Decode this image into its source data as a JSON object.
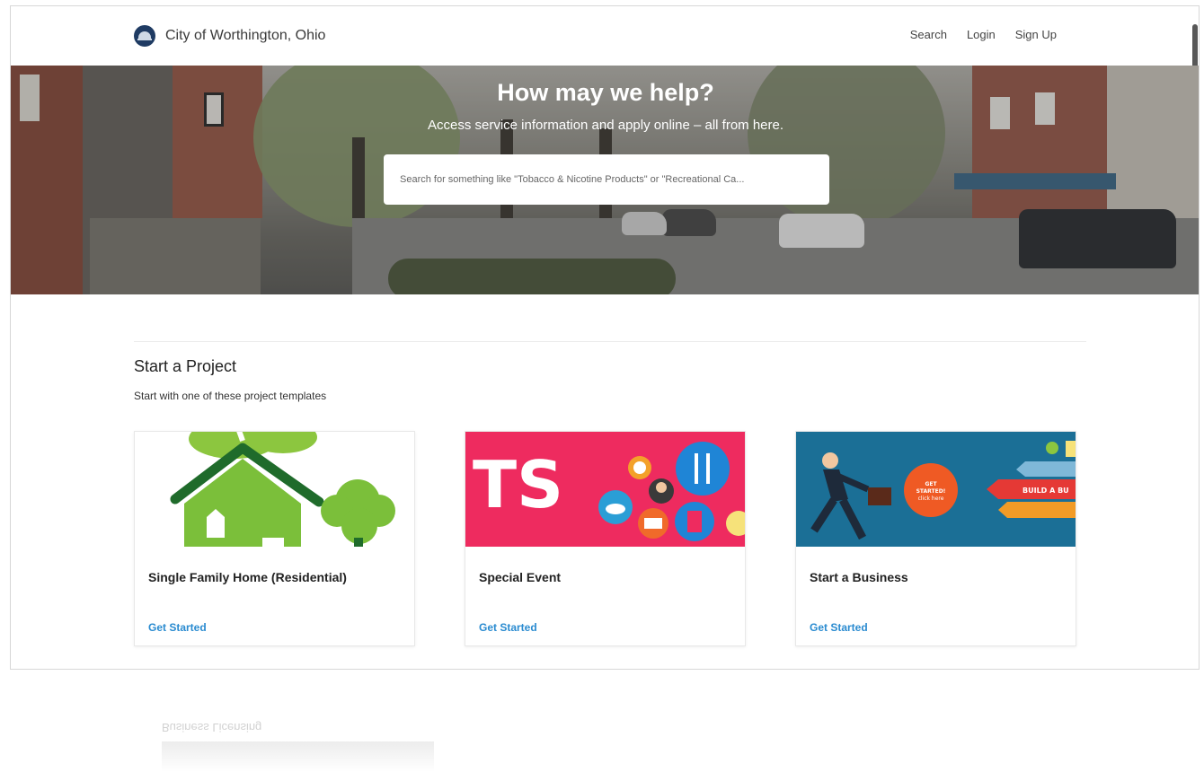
{
  "header": {
    "site_name": "City of Worthington, Ohio",
    "nav": {
      "search": "Search",
      "login": "Login",
      "signup": "Sign Up"
    }
  },
  "hero": {
    "title": "How may we help?",
    "subtitle": "Access service information and apply online – all from here.",
    "search_placeholder": "Search for something like \"Tobacco & Nicotine Products\" or \"Recreational Ca..."
  },
  "projects": {
    "title": "Start a Project",
    "subtitle": "Start with one of these project templates",
    "cards": [
      {
        "title": "Single Family Home (Residential)",
        "link": "Get Started",
        "image_icon": "house-tree-illustration"
      },
      {
        "title": "Special Event",
        "link": "Get Started",
        "image_icon": "event-icons-illustration",
        "image_text": "TS"
      },
      {
        "title": "Start a Business",
        "link": "Get Started",
        "image_icon": "businessman-running-illustration",
        "image_badge": [
          "GET",
          "STARTED!",
          "click here"
        ],
        "image_banner": "BUILD A BU"
      }
    ]
  },
  "reflection": {
    "label": "Business Licensing"
  },
  "colors": {
    "link": "#2a8bd0",
    "logo": "#1f3b63",
    "event_bg": "#ee2b5f",
    "business_bg": "#1b6f96"
  }
}
